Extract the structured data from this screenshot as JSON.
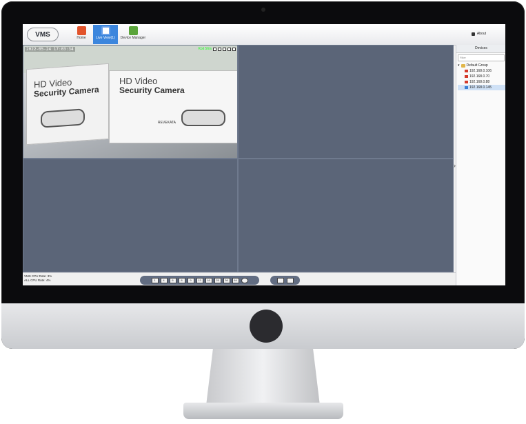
{
  "app": {
    "logo_text": "VMS",
    "toolbar": [
      {
        "label": "Home",
        "icon": "home-icon",
        "color": "#e2542c"
      },
      {
        "label": "Live View(1)",
        "icon": "live-view-icon",
        "color": "#6aa0e8"
      },
      {
        "label": "Device Manager",
        "icon": "device-manager-icon",
        "color": "#5aa43a"
      }
    ],
    "about_label": "About"
  },
  "video": {
    "osd_time": "2022-05-24 17:03:34",
    "osd_status": "Kbit 56/s",
    "box_line1": "HD Video",
    "box_line2": "Security Camera",
    "brand": "REVEKATA"
  },
  "devices": {
    "title": "Devices",
    "filter_placeholder": "Filter",
    "group": "Default Group",
    "items": [
      "192.168.0.106",
      "192.168.0.70",
      "192.168.0.88",
      "192.168.0.145"
    ],
    "selected_index": 3
  },
  "status": {
    "vms_cpu_label": "VMS CPU Rate:",
    "vms_cpu_value": "3%",
    "all_cpu_label": "ALL CPU Rate:",
    "all_cpu_value": "4%"
  },
  "layout_buttons": [
    "1",
    "4",
    "6",
    "8",
    "9",
    "13",
    "16",
    "25",
    "36",
    "64"
  ]
}
